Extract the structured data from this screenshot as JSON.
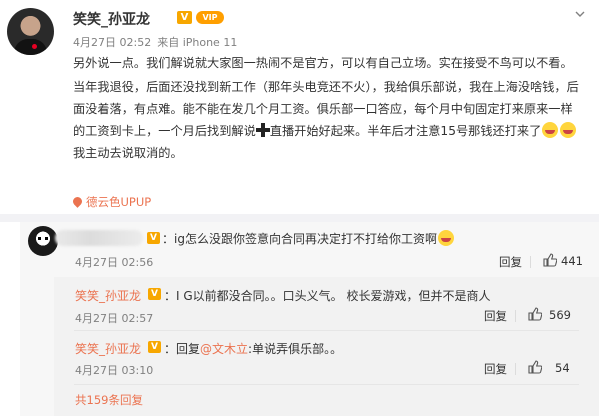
{
  "post": {
    "author": "笑笑_孙亚龙",
    "timestamp": "4月27日 02:52",
    "source": "来自 iPhone 11",
    "paragraphs": [
      "另外说一点。我们解说就大家图一热闹不是官方，可以有自己立场。实在接受不鸟可以不看。",
      "当年我退役，后面还没找到新工作（那年头电竞还不火），我给俱乐部说，我在上海没啥钱，后面没着落，有点难。能不能在发几个月工资。俱乐部一口答应，每个月中旬固定打来原来一样的工资到卡上，一个月后找到解说"
    ],
    "para2_after_plus": "直播开始好起来。半年后才注意15号那钱还打来了",
    "para2_end": "我主动去说取消的。",
    "location": "德云色UPUP"
  },
  "comment": {
    "text": "：ig怎么没跟你签意向合同再决定打不打给你工资啊",
    "time": "4月27日 02:56",
    "reply_label": "回复",
    "likes": "441"
  },
  "replies": [
    {
      "name": "笑笑_孙亚龙",
      "text": "：I G以前都没合同。。口头义气。 校长爱游戏，但并不是商人",
      "time": "4月27日 02:57",
      "reply_label": "回复",
      "likes": "569"
    },
    {
      "name": "笑笑_孙亚龙",
      "text_before": "：回复",
      "mention": "@文木立",
      "text_after": ":单说弄俱乐部。。",
      "time": "4月27日 03:10",
      "reply_label": "回复",
      "likes": "54"
    }
  ],
  "more_replies": "共159条回复",
  "icons": {
    "vip": "vip-v-icon",
    "like": "thumbs-up-icon",
    "location": "location-pin-icon",
    "chevron": "chevron-down-icon"
  },
  "colors": {
    "accent": "#eb7350",
    "vip": "#f7a700"
  }
}
